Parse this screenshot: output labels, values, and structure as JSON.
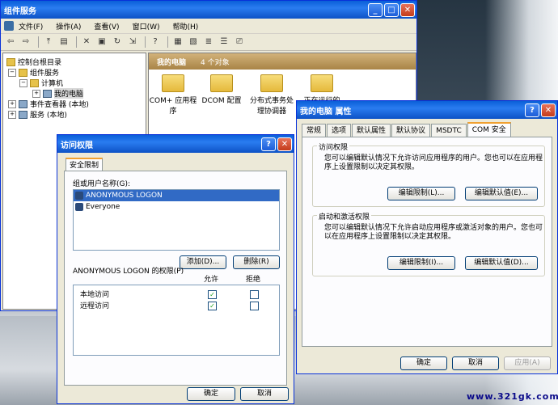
{
  "main_window": {
    "title": "组件服务",
    "menu": [
      "文件(F)",
      "操作(A)",
      "查看(V)",
      "窗口(W)",
      "帮助(H)"
    ],
    "tree": [
      {
        "label": "控制台根目录"
      },
      {
        "label": "组件服务"
      },
      {
        "label": "计算机"
      },
      {
        "label": "我的电脑"
      },
      {
        "label": "事件查看器 (本地)"
      },
      {
        "label": "服务 (本地)"
      }
    ],
    "right_header": "我的电脑",
    "right_count": "4 个对象",
    "folders": [
      "COM+ 应用程序",
      "DCOM 配置",
      "分布式事务处理协调器",
      "正在运行的"
    ]
  },
  "props_dialog": {
    "title": "我的电脑 属性",
    "tabs": [
      "常规",
      "选项",
      "默认属性",
      "默认协议",
      "MSDTC",
      "COM 安全"
    ],
    "access_group": {
      "label": "访问权限",
      "description": "您可以编辑默认情况下允许访问应用程序的用户。您也可以在应用程序上设置限制以决定其权限。",
      "edit_limits": "编辑限制(L)...",
      "edit_default": "编辑默认值(E)..."
    },
    "launch_group": {
      "label": "启动和激活权限",
      "description": "您可以编辑默认情况下允许启动应用程序或激活对象的用户。您也可以在应用程序上设置限制以决定其权限。",
      "edit_limits": "编辑限制(I)...",
      "edit_default": "编辑默认值(D)..."
    },
    "ok": "确定",
    "cancel": "取消",
    "apply": "应用(A)"
  },
  "access_dialog": {
    "title": "访问权限",
    "tab": "安全限制",
    "users_label": "组或用户名称(G):",
    "users": [
      "ANONYMOUS LOGON",
      "Everyone"
    ],
    "add": "添加(D)...",
    "remove": "删除(R)",
    "perm_label": "ANONYMOUS LOGON 的权限(P)",
    "col_allow": "允许",
    "col_deny": "拒绝",
    "permissions": [
      {
        "name": "本地访问",
        "allow": true,
        "deny": false
      },
      {
        "name": "远程访问",
        "allow": true,
        "deny": false
      }
    ],
    "ok": "确定",
    "cancel": "取消"
  },
  "watermark": "www.321gk.com"
}
